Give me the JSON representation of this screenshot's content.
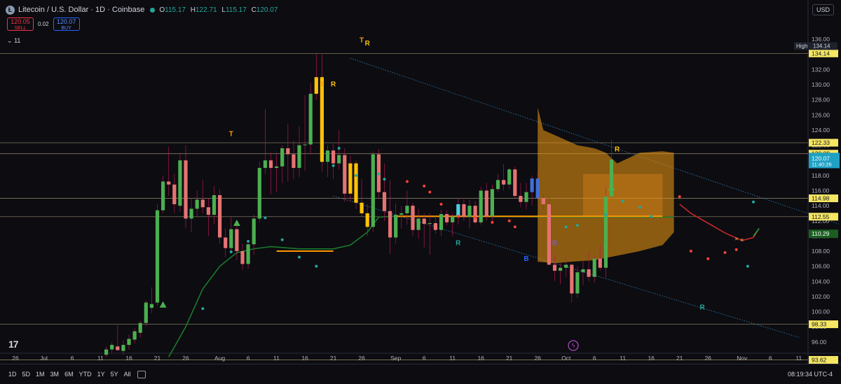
{
  "header": {
    "symbol_icon": "litecoin-icon",
    "title": "Litecoin / U.S. Dollar · 1D · Coinbase",
    "ohlc": {
      "o_label": "O",
      "o": "115.17",
      "h_label": "H",
      "h": "122.71",
      "l_label": "L",
      "l": "115.17",
      "c_label": "C",
      "c": "120.07"
    }
  },
  "trade": {
    "sell_price": "120.05",
    "sell_label": "SELL",
    "spread": "0.02",
    "buy_price": "120.07",
    "buy_label": "BUY"
  },
  "indicator_collapse": "11",
  "currency": "USD",
  "timeframes": [
    "1D",
    "5D",
    "1M",
    "3M",
    "6M",
    "YTD",
    "1Y",
    "5Y",
    "All"
  ],
  "clock": "08:19:34 UTC-4",
  "logo_text": "17",
  "colors": {
    "up": "#4caf50",
    "down": "#f44336",
    "highlight": "#ffc107",
    "cloud": "#f39c12",
    "background": "#0c0c11"
  },
  "chart_data": {
    "type": "candlestick",
    "ylim": [
      94.5,
      137.5
    ],
    "y_ticks": [
      96,
      98,
      100,
      102,
      104,
      106,
      108,
      110,
      112,
      114,
      116,
      118,
      120,
      122,
      124,
      126,
      128,
      130,
      132,
      134,
      136
    ],
    "x_ticks": [
      {
        "label": "26",
        "i": 0
      },
      {
        "label": "Jul",
        "i": 5
      },
      {
        "label": "6",
        "i": 10
      },
      {
        "label": "11",
        "i": 15
      },
      {
        "label": "16",
        "i": 20
      },
      {
        "label": "21",
        "i": 25
      },
      {
        "label": "26",
        "i": 30
      },
      {
        "label": "Aug",
        "i": 36
      },
      {
        "label": "6",
        "i": 41
      },
      {
        "label": "11",
        "i": 46
      },
      {
        "label": "16",
        "i": 51
      },
      {
        "label": "21",
        "i": 56
      },
      {
        "label": "26",
        "i": 61
      },
      {
        "label": "Sep",
        "i": 67
      },
      {
        "label": "6",
        "i": 72
      },
      {
        "label": "11",
        "i": 77
      },
      {
        "label": "16",
        "i": 82
      },
      {
        "label": "21",
        "i": 87
      },
      {
        "label": "26",
        "i": 92
      },
      {
        "label": "Oct",
        "i": 97
      },
      {
        "label": "6",
        "i": 102
      },
      {
        "label": "11",
        "i": 107
      },
      {
        "label": "16",
        "i": 112
      },
      {
        "label": "21",
        "i": 117
      },
      {
        "label": "26",
        "i": 122
      },
      {
        "label": "Nov",
        "i": 128
      },
      {
        "label": "6",
        "i": 133
      },
      {
        "label": "11",
        "i": 138
      }
    ],
    "first_candle_index": 16,
    "candles": [
      [
        94.3,
        95.4,
        94.0,
        95.0
      ],
      [
        95.0,
        96.0,
        94.6,
        95.6
      ],
      [
        95.4,
        98.2,
        95.0,
        94.9
      ],
      [
        94.8,
        96.2,
        94.3,
        95.6
      ],
      [
        95.6,
        97.0,
        95.0,
        96.4
      ],
      [
        96.3,
        97.8,
        95.8,
        97.4
      ],
      [
        97.2,
        98.8,
        96.6,
        98.5
      ],
      [
        98.5,
        101.5,
        98.0,
        101.2
      ],
      [
        100.5,
        103.2,
        99.8,
        101.0
      ],
      [
        101.2,
        114.2,
        100.8,
        113.4
      ],
      [
        113.4,
        118.0,
        113.0,
        117.2
      ],
      [
        117.2,
        121.8,
        115.3,
        116.8
      ],
      [
        116.8,
        118.2,
        113.0,
        114.2
      ],
      [
        114.0,
        121.0,
        113.2,
        120.0
      ],
      [
        120.0,
        122.0,
        111.0,
        112.3
      ],
      [
        112.3,
        115.0,
        110.5,
        113.6
      ],
      [
        113.6,
        116.0,
        112.5,
        114.8
      ],
      [
        114.8,
        117.4,
        113.0,
        113.8
      ],
      [
        113.8,
        115.0,
        110.0,
        112.8
      ],
      [
        112.8,
        116.6,
        111.5,
        115.4
      ],
      [
        115.4,
        116.2,
        109.0,
        109.8
      ],
      [
        109.8,
        111.0,
        107.2,
        108.4
      ],
      [
        108.4,
        112.5,
        107.8,
        110.9
      ],
      [
        110.9,
        111.5,
        106.8,
        108.0
      ],
      [
        108.0,
        109.0,
        105.5,
        106.3
      ],
      [
        106.3,
        109.2,
        105.7,
        108.9
      ],
      [
        108.9,
        112.8,
        107.5,
        112.3
      ],
      [
        112.3,
        119.8,
        111.8,
        119.0
      ],
      [
        119.0,
        126.8,
        118.2,
        120.0
      ],
      [
        120.0,
        121.0,
        115.5,
        119.0
      ],
      [
        119.0,
        121.0,
        115.8,
        119.2
      ],
      [
        119.2,
        122.0,
        117.0,
        121.6
      ],
      [
        121.6,
        124.8,
        117.2,
        120.8
      ],
      [
        120.8,
        122.6,
        117.5,
        119.0
      ],
      [
        119.0,
        124.5,
        117.8,
        122.0
      ],
      [
        122.0,
        128.6,
        118.6,
        122.1
      ],
      [
        122.1,
        130.2,
        120.8,
        128.8
      ],
      [
        128.8,
        134.1,
        128.0,
        131.0
      ],
      [
        131.0,
        134.0,
        118.5,
        119.8
      ],
      [
        119.8,
        122.0,
        117.8,
        121.3
      ],
      [
        121.3,
        122.2,
        117.5,
        119.6
      ],
      [
        119.6,
        124.0,
        118.8,
        120.7
      ],
      [
        120.7,
        121.6,
        114.5,
        115.6
      ],
      [
        115.6,
        120.6,
        114.5,
        119.6
      ],
      [
        119.6,
        120.0,
        113.6,
        114.4
      ],
      [
        114.4,
        117.5,
        112.6,
        113.0
      ],
      [
        113.0,
        114.2,
        110.0,
        111.2
      ],
      [
        111.2,
        121.2,
        110.5,
        120.8
      ],
      [
        120.8,
        121.5,
        115.0,
        115.8
      ],
      [
        115.8,
        119.6,
        112.0,
        113.3
      ],
      [
        113.3,
        117.4,
        107.6,
        109.8
      ],
      [
        109.8,
        114.3,
        109.0,
        112.8
      ],
      [
        112.8,
        114.0,
        111.0,
        113.0
      ],
      [
        113.0,
        116.0,
        111.5,
        114.0
      ],
      [
        114.0,
        114.4,
        110.0,
        110.8
      ],
      [
        110.8,
        113.6,
        109.6,
        112.3
      ],
      [
        112.3,
        113.0,
        108.5,
        111.6
      ],
      [
        111.6,
        113.0,
        107.5,
        111.7
      ],
      [
        111.7,
        112.6,
        110.3,
        110.8
      ],
      [
        110.8,
        113.5,
        110.0,
        112.9
      ],
      [
        112.9,
        113.4,
        111.4,
        111.8
      ],
      [
        111.8,
        113.0,
        110.0,
        112.6
      ],
      [
        112.6,
        115.0,
        111.5,
        114.2
      ],
      [
        114.2,
        114.8,
        112.0,
        112.5
      ],
      [
        112.5,
        114.8,
        111.0,
        114.0
      ],
      [
        114.0,
        114.6,
        111.5,
        111.8
      ],
      [
        111.8,
        116.5,
        111.5,
        116.0
      ],
      [
        116.0,
        117.0,
        112.0,
        112.6
      ],
      [
        112.6,
        116.8,
        112.0,
        116.2
      ],
      [
        116.2,
        118.2,
        115.8,
        117.4
      ],
      [
        117.4,
        119.5,
        116.0,
        116.8
      ],
      [
        116.8,
        119.0,
        116.2,
        118.8
      ],
      [
        118.8,
        119.2,
        115.0,
        115.3
      ],
      [
        115.3,
        117.0,
        113.8,
        114.5
      ],
      [
        114.5,
        117.0,
        113.5,
        115.8
      ],
      [
        115.8,
        118.0,
        114.0,
        117.6
      ],
      [
        117.6,
        118.5,
        114.8,
        115.0
      ],
      [
        115.0,
        115.6,
        113.5,
        114.2
      ],
      [
        114.2,
        115.2,
        106.5,
        106.2
      ],
      [
        106.2,
        107.6,
        104.0,
        105.4
      ],
      [
        105.4,
        106.4,
        103.6,
        105.8
      ],
      [
        105.8,
        107.2,
        104.6,
        106.2
      ],
      [
        106.2,
        106.4,
        101.2,
        102.4
      ],
      [
        102.4,
        106.0,
        101.8,
        105.2
      ],
      [
        105.2,
        106.8,
        103.5,
        105.6
      ],
      [
        105.6,
        108.0,
        104.0,
        104.6
      ],
      [
        104.6,
        107.4,
        103.8,
        107.0
      ],
      [
        107.0,
        108.8,
        105.4,
        105.8
      ],
      [
        105.8,
        116.5,
        104.5,
        115.2
      ],
      [
        115.2,
        122.7,
        115.0,
        120.1
      ]
    ],
    "highlight_candles": [
      13,
      14,
      53,
      54,
      59,
      60,
      61,
      62,
      121,
      122
    ],
    "blue_candles": [
      91,
      92
    ],
    "hlines": [
      {
        "value": 134.14,
        "label": "134.14",
        "style": "yellow-tag"
      },
      {
        "value": 122.33,
        "label": "122.33",
        "style": "yellow-tag"
      },
      {
        "value": 120.88,
        "label": "120.88",
        "style": "yellow-tag"
      },
      {
        "value": 114.98,
        "label": "114.98",
        "style": "yellow-tag"
      },
      {
        "value": 112.55,
        "label": "112.55",
        "style": "yellow-tag"
      },
      {
        "value": 98.33,
        "label": "98.33",
        "style": "yellow-tag"
      },
      {
        "value": 93.62,
        "label": "93.62",
        "style": "yellow-tag"
      }
    ],
    "price_tags": [
      {
        "value": 120.07,
        "label": "120.07",
        "sub": "11:40:26",
        "style": "current"
      },
      {
        "value": 110.29,
        "label": "110.29",
        "style": "green"
      }
    ],
    "high_marker": {
      "label": "High",
      "value": 134.14,
      "value_label": "134.14"
    },
    "markers": [
      {
        "i": 38,
        "v": 123.2,
        "text": "T",
        "color": "#ff9800"
      },
      {
        "i": 61,
        "v": 135.6,
        "text": "T",
        "color": "#ff9800"
      },
      {
        "i": 62,
        "v": 135.2,
        "text": "R",
        "color": "#ffc107"
      },
      {
        "i": 54,
        "v": 129.8,
        "text": "T",
        "color": "#ff9800"
      },
      {
        "i": 56,
        "v": 129.8,
        "text": "R",
        "color": "#ffc107"
      },
      {
        "i": 78,
        "v": 108.8,
        "text": "R",
        "color": "#26a69a"
      },
      {
        "i": 90,
        "v": 106.7,
        "text": "B",
        "color": "#2962ff"
      },
      {
        "i": 95,
        "v": 108.8,
        "text": "B",
        "color": "#7e57c2"
      },
      {
        "i": 106,
        "v": 121.2,
        "text": "R",
        "color": "#ffc107"
      },
      {
        "i": 121,
        "v": 100.3,
        "text": "R",
        "color": "#26a69a"
      }
    ],
    "triangles": [
      {
        "i": 26,
        "v": 100.9,
        "color": "#4caf50"
      },
      {
        "i": 39,
        "v": 111.7,
        "color": "#4caf50"
      },
      {
        "i": 105,
        "v": 116.4,
        "color": "#4caf50"
      }
    ],
    "cross_marks": [
      {
        "i": 127,
        "v": 109.6
      },
      {
        "i": 128,
        "v": 109.5
      }
    ],
    "trend_ma": [
      [
        27,
        94.0
      ],
      [
        30,
        98.0
      ],
      [
        33,
        103.0
      ],
      [
        36,
        106.0
      ],
      [
        39,
        107.8
      ],
      [
        42,
        108.3
      ],
      [
        45,
        108.6
      ],
      [
        50,
        108.3
      ],
      [
        56,
        108.3
      ],
      [
        59,
        108.8
      ],
      [
        62,
        110.5
      ],
      [
        64,
        112.5
      ],
      [
        66,
        112.6
      ],
      [
        72,
        112.6
      ],
      [
        82,
        112.6
      ],
      [
        96,
        112.5
      ],
      [
        108,
        112.5
      ],
      [
        114,
        112.5
      ],
      [
        116,
        112.5
      ]
    ],
    "red_ma": [
      [
        117,
        114.2
      ],
      [
        119,
        113.0
      ],
      [
        122,
        111.7
      ],
      [
        125,
        110.4
      ],
      [
        128,
        109.4
      ],
      [
        130,
        109.8
      ],
      [
        131,
        111.0
      ]
    ],
    "orange_segments": [
      [
        [
          46,
          108.0
        ],
        [
          56,
          108.0
        ]
      ],
      [
        [
          67,
          112.6
        ],
        [
          114,
          112.6
        ]
      ]
    ],
    "channel_upper": [
      [
        59,
        133.5
      ],
      [
        145,
        111.6
      ]
    ],
    "channel_lower": [
      [
        56,
        115.3
      ],
      [
        138,
        96.6
      ]
    ],
    "cloud": [
      [
        92,
        127.0
      ],
      [
        93,
        124.0
      ],
      [
        96,
        123.0
      ],
      [
        99,
        122.0
      ],
      [
        102,
        121.6
      ],
      [
        104,
        121.0
      ],
      [
        106,
        119.6
      ],
      [
        108,
        120.3
      ],
      [
        110,
        121.0
      ],
      [
        114,
        121.2
      ],
      [
        116,
        121.0
      ],
      [
        116,
        110.5
      ],
      [
        114,
        108.8
      ],
      [
        110,
        108.0
      ],
      [
        106,
        107.4
      ],
      [
        102,
        106.8
      ],
      [
        98,
        106.6
      ],
      [
        95,
        106.4
      ],
      [
        92,
        106.6
      ]
    ],
    "cloud_inner": [
      [
        100,
        118.2
      ],
      [
        114,
        118.2
      ],
      [
        114,
        112.6
      ],
      [
        100,
        112.6
      ]
    ],
    "dots": [
      [
        33,
        100.4,
        "#26a69a"
      ],
      [
        38,
        107.9,
        "#26a69a"
      ],
      [
        41,
        109.3,
        "#26a69a"
      ],
      [
        44,
        112.4,
        "#26a69a"
      ],
      [
        47,
        109.5,
        "#26a69a"
      ],
      [
        50,
        107.2,
        "#26a69a"
      ],
      [
        53,
        106.0,
        "#26a69a"
      ],
      [
        56,
        119.3,
        "#26a69a"
      ],
      [
        57,
        121.6,
        "#26a69a"
      ],
      [
        60,
        118.0,
        "#26a69a"
      ],
      [
        64,
        118.2,
        "#26a69a"
      ],
      [
        65,
        117.5,
        "#26a69a"
      ],
      [
        69,
        117.2,
        "#f44336"
      ],
      [
        72,
        116.6,
        "#f44336"
      ],
      [
        73,
        115.8,
        "#f44336"
      ],
      [
        75,
        114.2,
        "#f44336"
      ],
      [
        78,
        112.6,
        "#f44336"
      ],
      [
        81,
        112.4,
        "#f44336"
      ],
      [
        84,
        111.8,
        "#f44336"
      ],
      [
        87,
        112.0,
        "#f44336"
      ],
      [
        88,
        111.2,
        "#f44336"
      ],
      [
        97,
        111.2,
        "#26a69a"
      ],
      [
        99,
        111.4,
        "#26a69a"
      ],
      [
        104,
        112.8,
        "#26a69a"
      ],
      [
        107,
        114.6,
        "#26a69a"
      ],
      [
        110,
        113.8,
        "#26a69a"
      ],
      [
        112,
        112.6,
        "#26a69a"
      ],
      [
        117,
        115.2,
        "#f44336"
      ],
      [
        119,
        108.0,
        "#f44336"
      ],
      [
        122,
        107.0,
        "#f44336"
      ],
      [
        125,
        107.8,
        "#f44336"
      ],
      [
        127,
        108.2,
        "#f44336"
      ],
      [
        129,
        106.0,
        "#26a69a"
      ],
      [
        130,
        114.5,
        "#26a69a"
      ]
    ]
  }
}
